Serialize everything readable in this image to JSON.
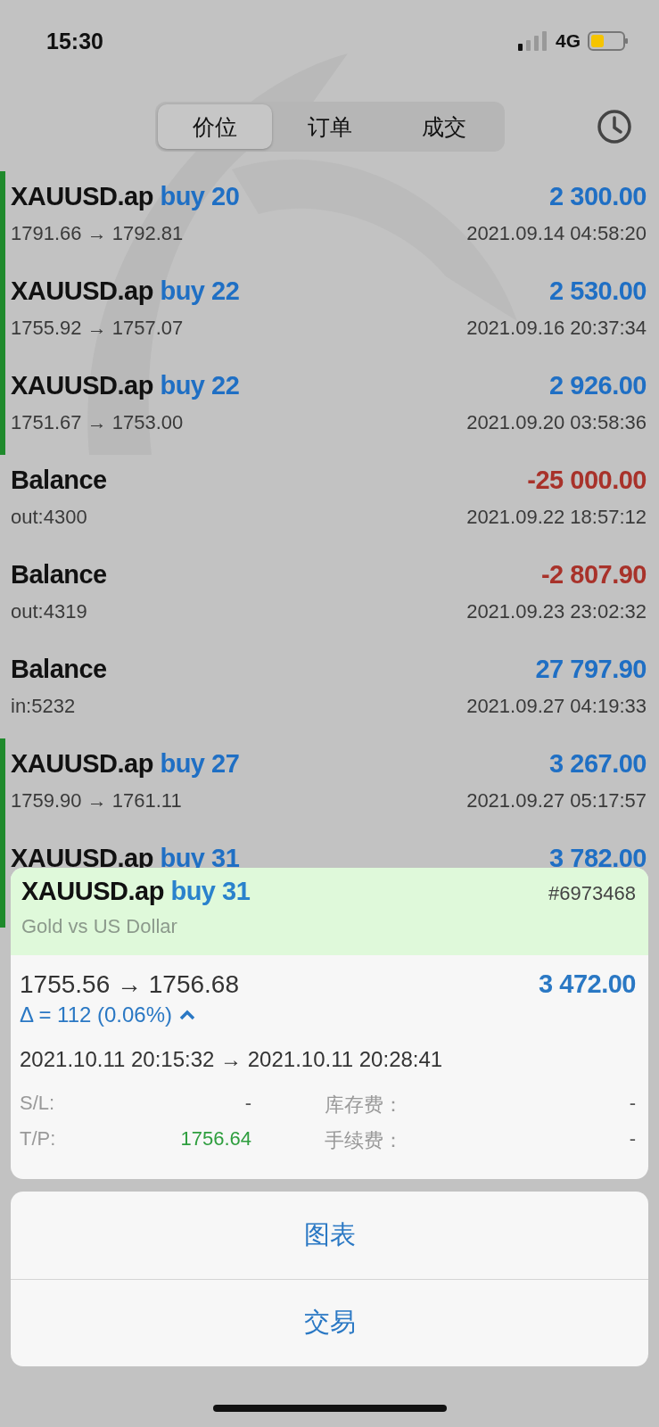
{
  "status_bar": {
    "time": "15:30",
    "network": "4G"
  },
  "tabs": [
    {
      "label": "价位",
      "selected": true
    },
    {
      "label": "订单",
      "selected": false
    },
    {
      "label": "成交",
      "selected": false
    }
  ],
  "deals": [
    {
      "kind": "deal",
      "symbol": "XAUUSD.ap",
      "action": "buy 20",
      "amount": "2 300.00",
      "color": "#1f6fc4",
      "detail": "1791.66 → 1792.81",
      "time": "2021.09.14 04:58:20"
    },
    {
      "kind": "deal",
      "symbol": "XAUUSD.ap",
      "action": "buy 22",
      "amount": "2 530.00",
      "color": "#1f6fc4",
      "detail": "1755.92 → 1757.07",
      "time": "2021.09.16 20:37:34"
    },
    {
      "kind": "deal",
      "symbol": "XAUUSD.ap",
      "action": "buy 22",
      "amount": "2 926.00",
      "color": "#1f6fc4",
      "detail": "1751.67 → 1753.00",
      "time": "2021.09.20 03:58:36"
    },
    {
      "kind": "balance",
      "title": "Balance",
      "amount": "-25 000.00",
      "color": "#a8322a",
      "detail": "out:4300",
      "time": "2021.09.22 18:57:12"
    },
    {
      "kind": "balance",
      "title": "Balance",
      "amount": "-2 807.90",
      "color": "#a8322a",
      "detail": "out:4319",
      "time": "2021.09.23 23:02:32"
    },
    {
      "kind": "balance",
      "title": "Balance",
      "amount": "27 797.90",
      "color": "#1f6fc4",
      "detail": "in:5232",
      "time": "2021.09.27 04:19:33"
    },
    {
      "kind": "deal",
      "symbol": "XAUUSD.ap",
      "action": "buy 27",
      "amount": "3 267.00",
      "color": "#1f6fc4",
      "detail": "1759.90 → 1761.11",
      "time": "2021.09.27 05:17:57"
    },
    {
      "kind": "deal",
      "symbol": "XAUUSD.ap",
      "action": "buy 31",
      "amount": "3 782.00",
      "color": "#1f6fc4"
    }
  ],
  "detail_card": {
    "symbol": "XAUUSD.ap",
    "action": "buy 31",
    "ticket": "#6973468",
    "description": "Gold vs US Dollar",
    "prices": "1755.56 → 1756.68",
    "profit": "3 472.00",
    "delta": "Δ = 112 (0.06%)",
    "expanded": true,
    "times": "2021.10.11 20:15:32 → 2021.10.11 20:28:41",
    "fields": [
      {
        "label": "S/L:",
        "value": "-",
        "color": "#555555"
      },
      {
        "label": "库存费：",
        "value": "-",
        "color": "#555555"
      },
      {
        "label": "T/P:",
        "value": "1756.64",
        "color": "#2e9e3e"
      },
      {
        "label": "手续费：",
        "value": "-",
        "color": "#555555"
      }
    ]
  },
  "actions": [
    "图表",
    "交易"
  ]
}
